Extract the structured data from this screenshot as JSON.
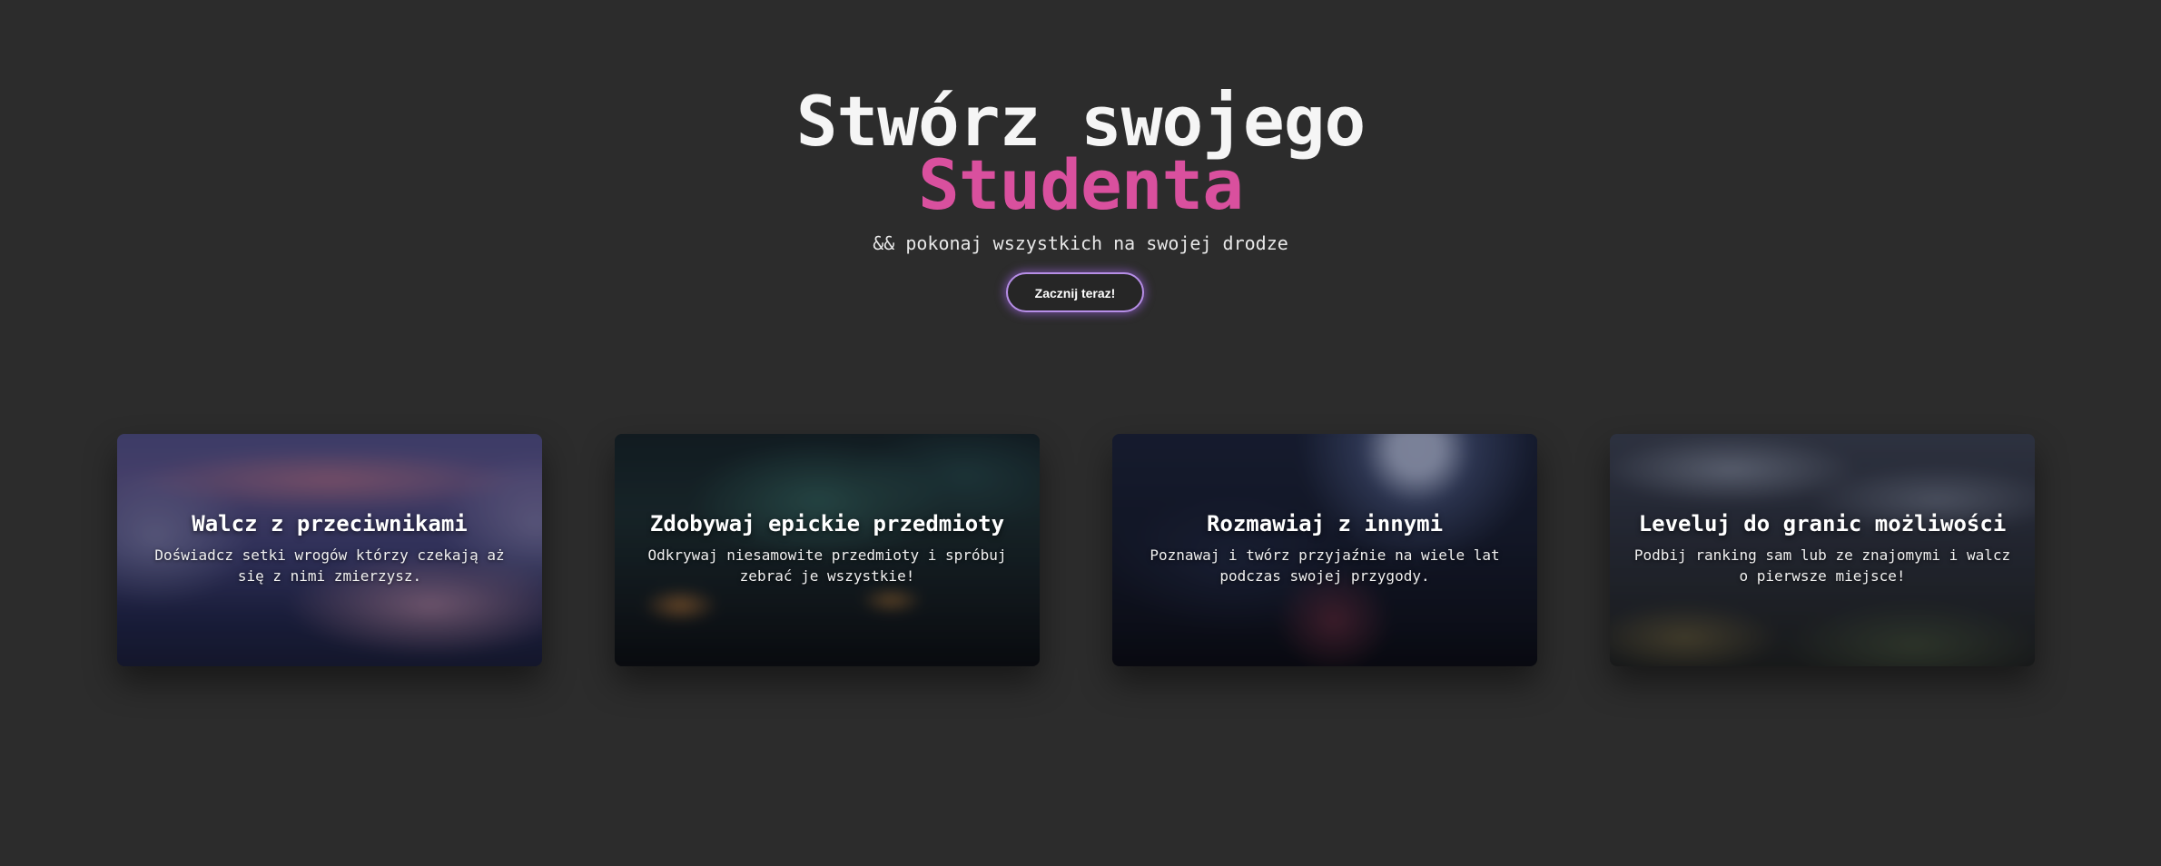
{
  "hero": {
    "title_line1": "Stwórz swojego",
    "title_line2": "Studenta",
    "subtitle": "&& pokonaj wszystkich na swojej drodze",
    "cta_label": "Zacznij teraz!"
  },
  "colors": {
    "background": "#2c2c2c",
    "accent": "#d9509e",
    "cta_glow": "#b68ee6"
  },
  "features": [
    {
      "title": "Walcz z przeciwnikami",
      "description": "Doświadcz setki wrogów którzy czekają aż się z nimi zmierzysz."
    },
    {
      "title": "Zdobywaj epickie przedmioty",
      "description": "Odkrywaj niesamowite przedmioty i spróbuj zebrać je wszystkie!"
    },
    {
      "title": "Rozmawiaj z innymi",
      "description": "Poznawaj i twórz przyjaźnie na wiele lat podczas swojej przygody."
    },
    {
      "title": "Leveluj do granic możliwości",
      "description": "Podbij ranking sam lub ze znajomymi i walcz o pierwsze miejsce!"
    }
  ]
}
